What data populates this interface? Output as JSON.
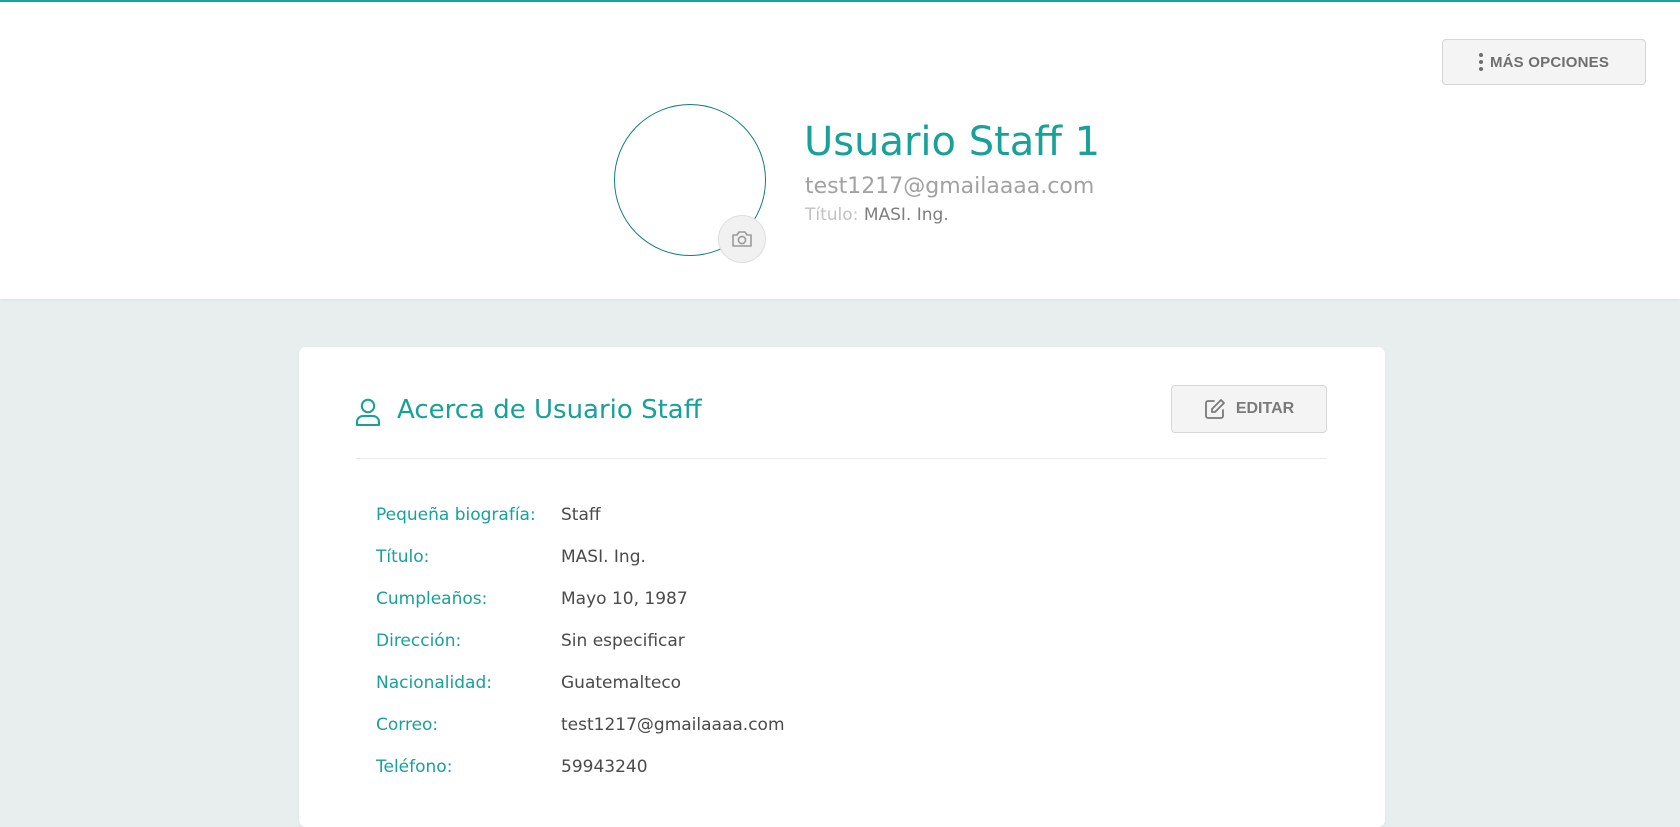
{
  "header": {
    "more_options_label": "MÁS OPCIONES",
    "user_name": "Usuario Staff 1",
    "user_email": "test1217@gmailaaaa.com",
    "title_label": "Título:",
    "title_value": "MASI. Ing."
  },
  "about": {
    "title": "Acerca de Usuario Staff",
    "edit_label": "EDITAR",
    "fields": [
      {
        "label": "Pequeña biografía:",
        "value": "Staff"
      },
      {
        "label": "Título:",
        "value": "MASI. Ing."
      },
      {
        "label": "Cumpleaños:",
        "value": "Mayo 10, 1987"
      },
      {
        "label": "Dirección:",
        "value": "Sin especificar"
      },
      {
        "label": "Nacionalidad:",
        "value": "Guatemalteco"
      },
      {
        "label": "Correo:",
        "value": "test1217@gmailaaaa.com"
      },
      {
        "label": "Teléfono:",
        "value": "59943240"
      }
    ]
  },
  "colors": {
    "accent": "#17a199",
    "accent_dark": "#127f7a",
    "page_background": "#e8eeee"
  },
  "icons": {
    "more": "kebab-menu-icon",
    "avatar_upload": "camera-icon",
    "about": "user-icon",
    "edit": "edit-icon"
  }
}
